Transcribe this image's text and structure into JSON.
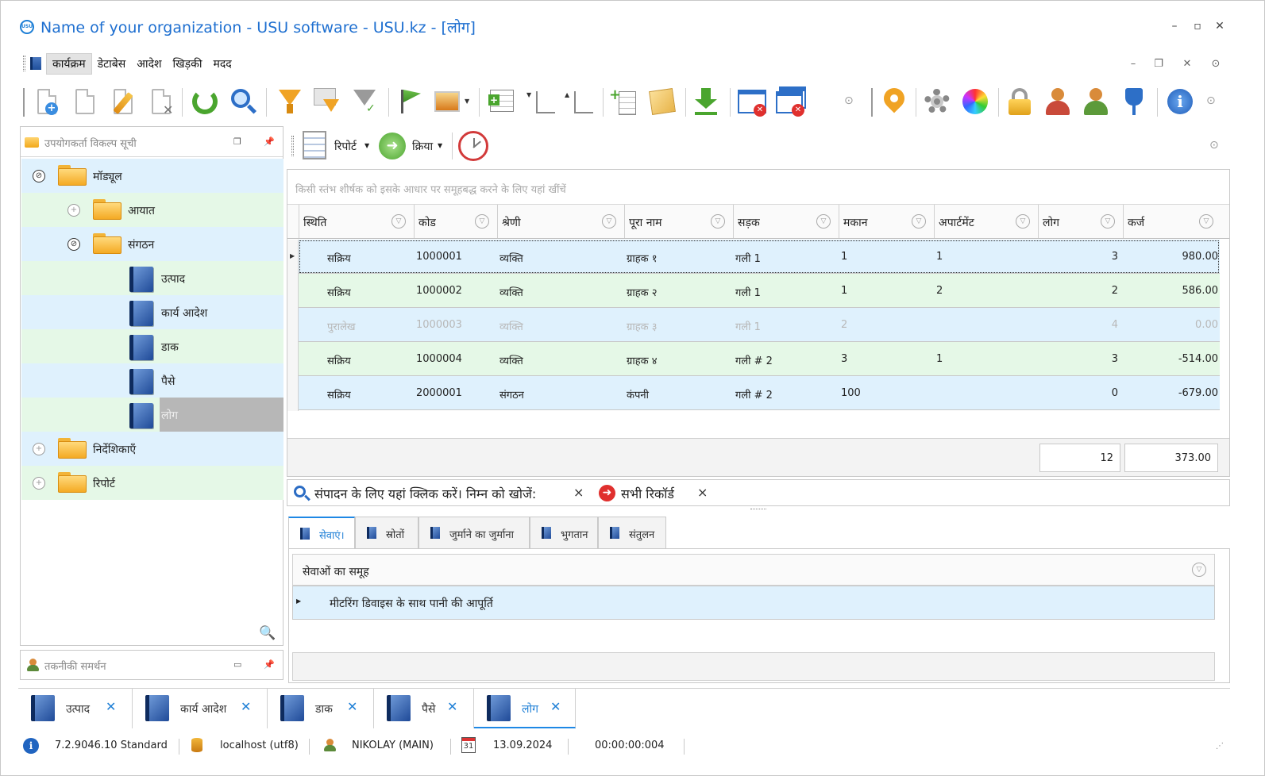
{
  "window": {
    "title": "Name of your organization - USU software - USU.kz - [लोग]",
    "logo_text": "USU"
  },
  "menu": {
    "items": [
      "कार्यक्रम",
      "डेटाबेस",
      "आदेश",
      "खिड़की",
      "मदद"
    ]
  },
  "left_panel": {
    "title": "उपयोगकर्ता विकल्प सूची",
    "tree": {
      "modules": "मॉड्यूल",
      "import": "आयात",
      "organization": "संगठन",
      "products": "उत्पाद",
      "work_orders": "कार्य आदेश",
      "mail": "डाक",
      "money": "पैसे",
      "people": "लोग",
      "directories": "निर्देशिकाएँ",
      "reports": "रिपोर्ट"
    }
  },
  "support_panel": {
    "title": "तकनीकी समर्थन"
  },
  "report_toolbar": {
    "report_label": "रिपोर्ट",
    "action_label": "क्रिया"
  },
  "grid": {
    "group_hint": "किसी स्तंभ शीर्षक को इसके आधार पर समूहबद्ध करने के लिए यहां खींचें",
    "columns": [
      "स्थिति",
      "कोड",
      "श्रेणी",
      "पूरा नाम",
      "सड़क",
      "मकान",
      "अपार्टमेंट",
      "लोग",
      "कर्ज"
    ],
    "rows": [
      {
        "status": "सक्रिय",
        "code": "1000001",
        "category": "व्यक्ति",
        "name": "ग्राहक १",
        "street": "गली 1",
        "house": "1",
        "apt": "1",
        "people": "3",
        "debt": "980.00"
      },
      {
        "status": "सक्रिय",
        "code": "1000002",
        "category": "व्यक्ति",
        "name": "ग्राहक २",
        "street": "गली 1",
        "house": "1",
        "apt": "2",
        "people": "2",
        "debt": "586.00"
      },
      {
        "status": "पुरालेख",
        "code": "1000003",
        "category": "व्यक्ति",
        "name": "ग्राहक ३",
        "street": "गली 1",
        "house": "2",
        "apt": "",
        "people": "4",
        "debt": "0.00"
      },
      {
        "status": "सक्रिय",
        "code": "1000004",
        "category": "व्यक्ति",
        "name": "ग्राहक ४",
        "street": "गली # 2",
        "house": "3",
        "apt": "1",
        "people": "3",
        "debt": "-514.00"
      },
      {
        "status": "सक्रिय",
        "code": "2000001",
        "category": "संगठन",
        "name": "कंपनी",
        "street": "गली # 2",
        "house": "100",
        "apt": "",
        "people": "0",
        "debt": "-679.00"
      }
    ],
    "footer": {
      "people_total": "12",
      "debt_total": "373.00"
    }
  },
  "filter_bar": {
    "search_text": "संपादन के लिए यहां क्लिक करें। निम्न को खोजें:",
    "all_records": "सभी रिकॉर्ड",
    "close_symbol": "×"
  },
  "detail_tabs": [
    "सेवाएं।",
    "स्रोतों",
    "जुर्माने का जुर्माना",
    "भुगतान",
    "संतुलन"
  ],
  "subgrid": {
    "column": "सेवाओं का समूह",
    "row": "मीटरिंग डिवाइस के साथ पानी की आपूर्ति"
  },
  "doc_tabs": [
    "उत्पाद",
    "कार्य आदेश",
    "डाक",
    "पैसे",
    "लोग"
  ],
  "status_bar": {
    "version": "7.2.9046.10 Standard",
    "server": "localhost (utf8)",
    "user": "NIKOLAY (MAIN)",
    "date": "13.09.2024",
    "elapsed": "00:00:00:004",
    "calendar_day": "31"
  },
  "colors": {
    "accent": "#1e7fd6",
    "row_blue": "#dff1fd",
    "row_green": "#e5f8e7",
    "selection_gray": "#b7b7b7"
  }
}
